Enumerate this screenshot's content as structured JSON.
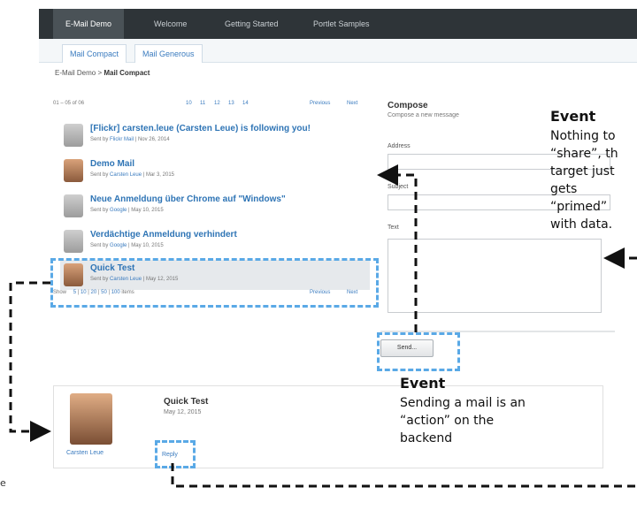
{
  "portal": {
    "tabs": [
      "E-Mail Demo",
      "Welcome",
      "Getting Started",
      "Portlet Samples"
    ],
    "subtabs": [
      "Mail Compact",
      "Mail Generous"
    ],
    "breadcrumb_root": "E-Mail Demo",
    "breadcrumb_sep": ">",
    "breadcrumb_current": "Mail Compact"
  },
  "list": {
    "range": "01 – 05 of 06",
    "pages": [
      "10",
      "11",
      "12",
      "13",
      "14"
    ],
    "previous": "Previous",
    "next": "Next",
    "sent_by_prefix": "Sent by",
    "items": [
      {
        "subject": "[Flickr] carsten.leue (Carsten Leue) is following you!",
        "sender": "Flickr Mail",
        "date": "Nov 26, 2014"
      },
      {
        "subject": "Demo Mail",
        "sender": "Carsten Leue",
        "date": "Mar 3, 2015"
      },
      {
        "subject": "Neue Anmeldung über Chrome auf \"Windows\"",
        "sender": "Google",
        "date": "May 10, 2015"
      },
      {
        "subject": "Verdächtige Anmeldung verhindert",
        "sender": "Google",
        "date": "May 10, 2015"
      },
      {
        "subject": "Quick Test",
        "sender": "Carsten Leue",
        "date": "May 12, 2015"
      }
    ],
    "show_label": "Show",
    "show_options": [
      "5",
      "10",
      "20",
      "50",
      "100"
    ],
    "items_label": "items"
  },
  "compose": {
    "title": "Compose",
    "subtitle": "Compose a new message",
    "address_label": "Address",
    "subject_label": "Subject",
    "text_label": "Text",
    "send_label": "Send..."
  },
  "detail": {
    "subject": "Quick Test",
    "date": "May 12, 2015",
    "name": "Carsten Leue",
    "reply": "Reply"
  },
  "annotations": {
    "event1_title": "Event",
    "event1_lines": [
      "Nothing to",
      "“share”, th",
      "target just",
      "gets",
      "“primed”",
      "with data."
    ],
    "event2_title": "Event",
    "event2_lines": [
      "Sending a mail is an",
      "“action” on the",
      "backend"
    ],
    "clipped_left_text": "e"
  },
  "colors": {
    "link_blue": "#2e74b5",
    "annotation_blue": "#5aa9e6",
    "annotation_black": "#111111",
    "topbar": "#2e3438"
  }
}
